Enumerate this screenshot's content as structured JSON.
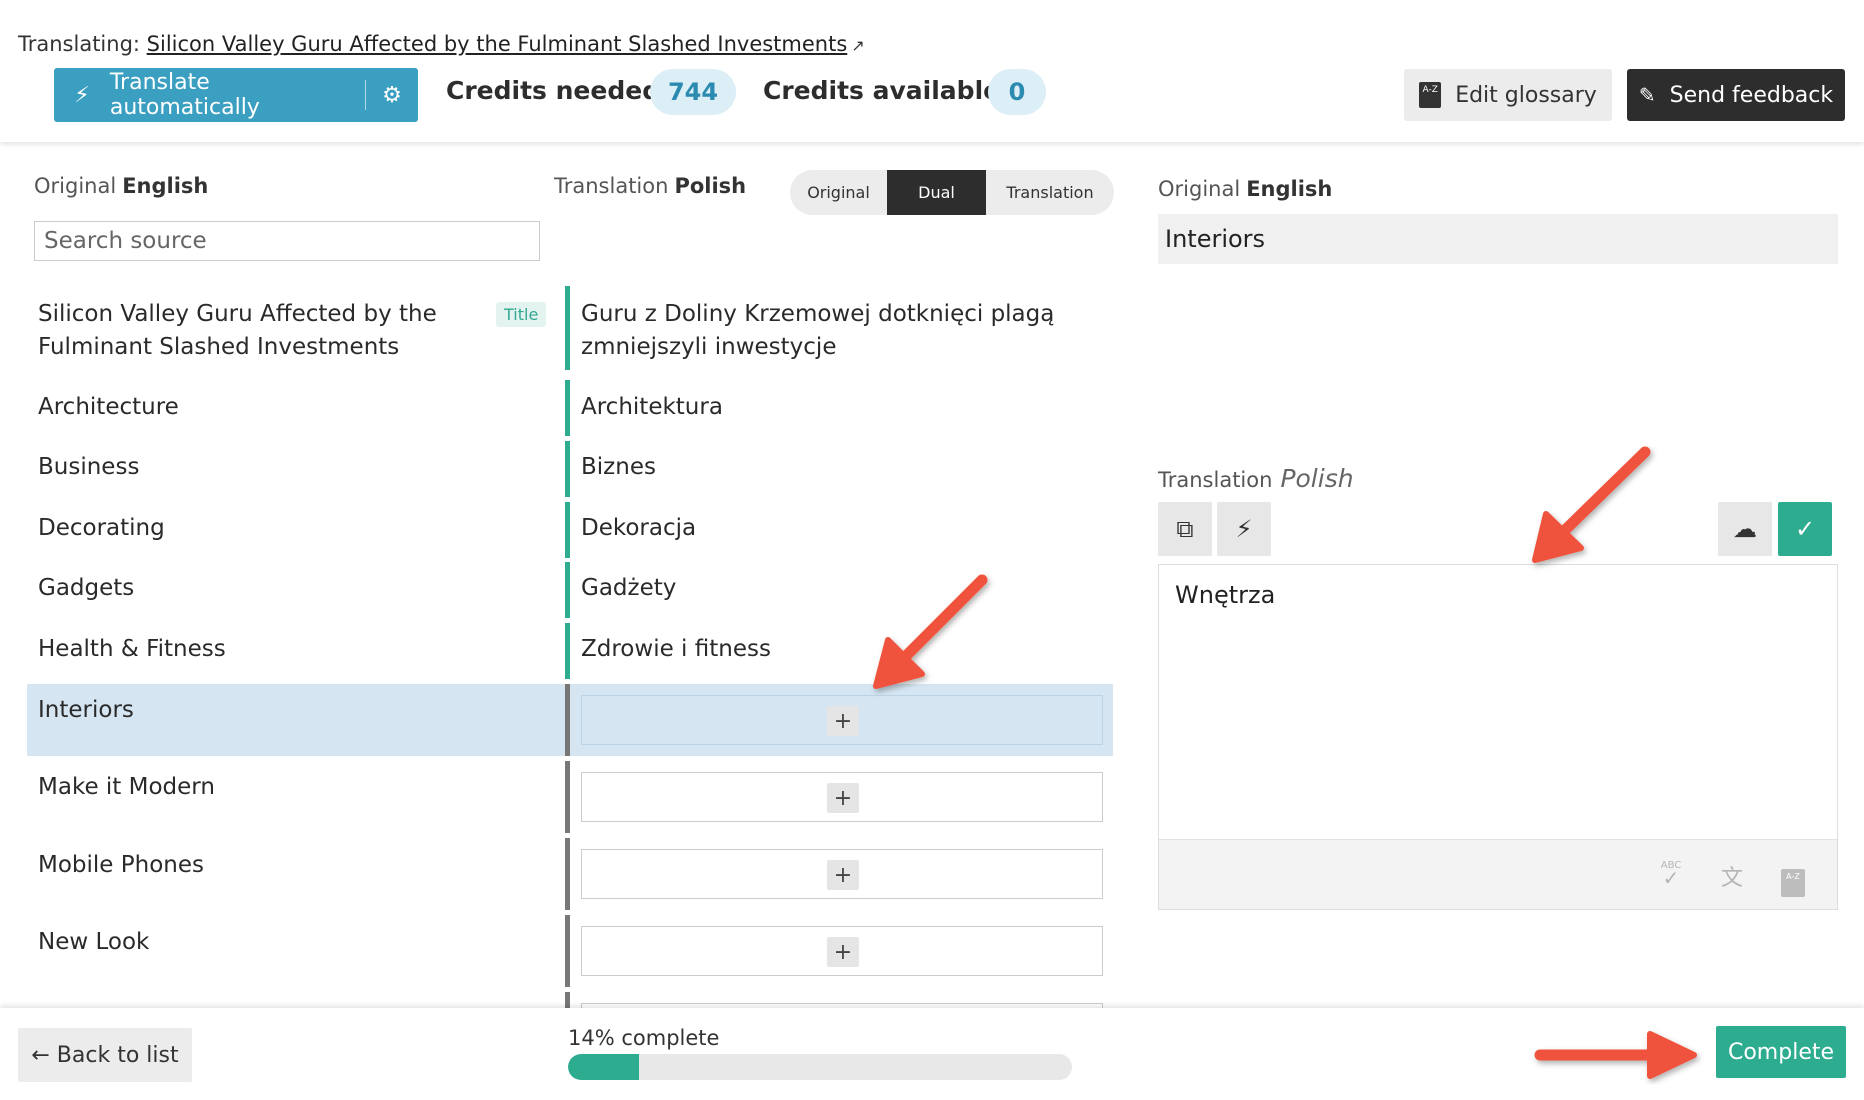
{
  "header": {
    "translating_label": "Translating:",
    "article_title": "Silicon Valley Guru Affected by the Fulminant Slashed Investments",
    "translate_auto_label": "Translate automatically",
    "credits_needed_label": "Credits needed",
    "credits_needed_value": "744",
    "credits_available_label": "Credits available",
    "credits_available_value": "0",
    "edit_glossary_label": "Edit glossary",
    "glossary_icon_text": "A-Z",
    "send_feedback_label": "Send feedback"
  },
  "columns": {
    "original_label": "Original",
    "original_lang": "English",
    "translation_label": "Translation",
    "translation_lang": "Polish",
    "search_placeholder": "Search source"
  },
  "view_toggle": {
    "options": [
      "Original",
      "Dual",
      "Translation"
    ],
    "selected": "Dual"
  },
  "rows": [
    {
      "source": "Silicon Valley Guru Affected by the Fulminant Slashed Investments",
      "badge": "Title",
      "translation": "Guru z Doliny Krzemowej dotknięci plagą zmniejszyli inwestycje",
      "status": "done"
    },
    {
      "source": "Architecture",
      "translation": "Architektura",
      "status": "done"
    },
    {
      "source": "Business",
      "translation": "Biznes",
      "status": "done"
    },
    {
      "source": "Decorating",
      "translation": "Dekoracja",
      "status": "done"
    },
    {
      "source": "Gadgets",
      "translation": "Gadżety",
      "status": "done"
    },
    {
      "source": "Health & Fitness",
      "translation": "Zdrowie i fitness",
      "status": "done"
    },
    {
      "source": "Interiors",
      "translation": "",
      "status": "active"
    },
    {
      "source": "Make it Modern",
      "translation": "",
      "status": "todo"
    },
    {
      "source": "Mobile Phones",
      "translation": "",
      "status": "todo"
    },
    {
      "source": "New Look",
      "translation": "",
      "status": "todo"
    }
  ],
  "plus_label": "+",
  "editor_panel": {
    "original_label": "Original",
    "original_lang": "English",
    "original_text": "Interiors",
    "translation_label": "Translation",
    "translation_lang": "Polish",
    "translation_text": "Wnętrza",
    "spellcheck_icon_text": "ABC"
  },
  "footer": {
    "back_label": "← Back to list",
    "progress_text": "14% complete",
    "progress_value": 0.14,
    "complete_label": "Complete"
  },
  "colors": {
    "accent_blue": "#3a9fc0",
    "accent_green": "#2eac90",
    "active_row": "#d5e5f2",
    "dark_button": "#2d2d2d",
    "annotation_arrow": "#f0533d"
  }
}
